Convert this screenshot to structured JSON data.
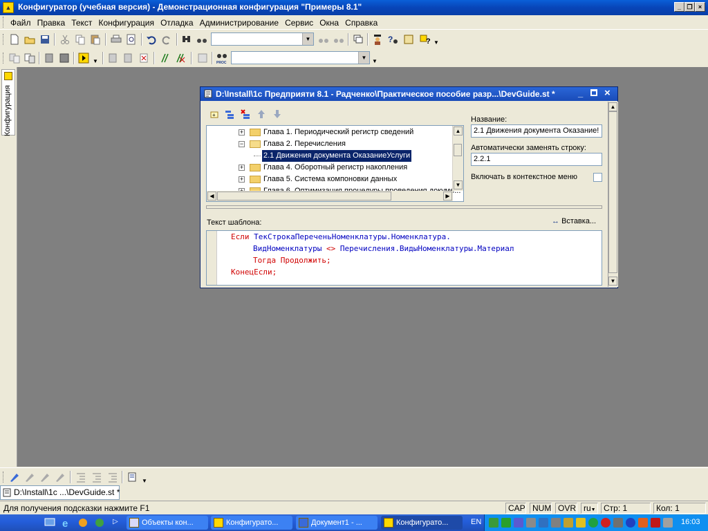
{
  "app": {
    "title": "Конфигуратор (учебная версия) - Демонстрационная конфигурация \"Примеры 8.1\"",
    "minimize": "_",
    "restore": "❐",
    "close": "×"
  },
  "menu": {
    "items": [
      "Файл",
      "Правка",
      "Текст",
      "Конфигурация",
      "Отладка",
      "Администрирование",
      "Сервис",
      "Окна",
      "Справка"
    ]
  },
  "side_panel": {
    "tab_label": "Конфигурация"
  },
  "dialog": {
    "title": "D:\\Install\\1с Предприяти 8.1 - Радченко\\Практическое пособие разр...\\DevGuide.st *",
    "tree": [
      {
        "label": "Глава 1. Периодический регистр сведений",
        "expanded": false
      },
      {
        "label": "Глава 2. Перечисления",
        "expanded": true
      },
      {
        "label": "2.1 Движения документа ОказаниеУслуги",
        "selected": true
      },
      {
        "label": "Глава 4. Оборотный регистр накопления",
        "expanded": false
      },
      {
        "label": "Глава 5. Система компоновки данных",
        "expanded": false
      },
      {
        "label": "Глава 6. Оптимизация процедуры проведения докуме...",
        "expanded": false
      }
    ],
    "name_label": "Название:",
    "name_value": "2.1 Движения документа Оказание!",
    "replace_label": "Автоматически заменять строку:",
    "replace_value": "2.2.1",
    "context_menu_label": "Включать в контекстное меню",
    "template_label": "Текст шаблона:",
    "insert_label": "Вставка...",
    "code": {
      "line1_kw": "Если",
      "line1_rest": "ТекСтрокаПереченьНоменклатуры.Номенклатура.",
      "line2_a": "ВидНоменклатуры",
      "line2_op": "<>",
      "line2_b": "Перечисления.ВидыНоменклатуры.Материал",
      "line3_kw": "Тогда Продолжить;",
      "line4_kw": "КонецЕсли;"
    }
  },
  "doc_tab": "D:\\Install\\1c ...\\DevGuide.st *",
  "status": {
    "hint": "Для получения подсказки нажмите F1",
    "cap": "CAP",
    "num": "NUM",
    "ovr": "OVR",
    "lang": "ru",
    "line": "Стр: 1",
    "col": "Кол: 1"
  },
  "taskbar": {
    "buttons": [
      "Объекты кон...",
      "Конфигурато...",
      "Документ1 - ...",
      "Конфигурато..."
    ],
    "lang": "EN",
    "clock": "16:03"
  }
}
